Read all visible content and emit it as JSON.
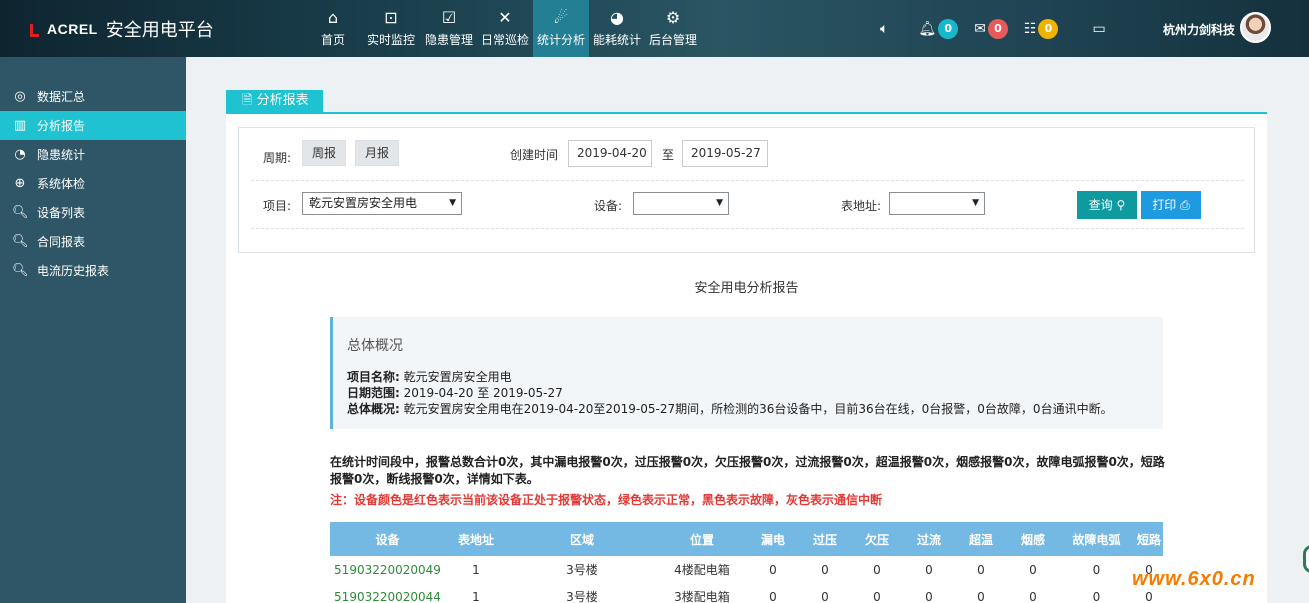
{
  "brand": {
    "logo": "ACREL",
    "title": "安全用电平台"
  },
  "nav": [
    {
      "label": "首页",
      "icon": "home-icon",
      "glyph": "⌂"
    },
    {
      "label": "实时监控",
      "icon": "monitor-search-icon",
      "glyph": "⊡"
    },
    {
      "label": "隐患管理",
      "icon": "clipboard-check-icon",
      "glyph": "☑"
    },
    {
      "label": "日常巡检",
      "icon": "tools-icon",
      "glyph": "✕"
    },
    {
      "label": "统计分析",
      "icon": "analysis-icon",
      "glyph": "☄"
    },
    {
      "label": "能耗统计",
      "icon": "pie-chart-icon",
      "glyph": "◕"
    },
    {
      "label": "后台管理",
      "icon": "gears-icon",
      "glyph": "⚙"
    }
  ],
  "header_tools": {
    "bell_count": "0",
    "mail_count": "0",
    "list_count": "0",
    "company": "杭州力剑科技"
  },
  "sidebar": [
    {
      "label": "数据汇总",
      "icon": "dashboard-icon",
      "glyph": "◎"
    },
    {
      "label": "分析报告",
      "icon": "bar-chart-icon",
      "glyph": "▥"
    },
    {
      "label": "隐患统计",
      "icon": "clock-icon",
      "glyph": "◔"
    },
    {
      "label": "系统体检",
      "icon": "plus-circle-icon",
      "glyph": "⊕"
    },
    {
      "label": "设备列表",
      "icon": "search-icon",
      "glyph": "🔍︎"
    },
    {
      "label": "合同报表",
      "icon": "search-icon",
      "glyph": "🔍︎"
    },
    {
      "label": "电流历史报表",
      "icon": "search-icon",
      "glyph": "🔍︎"
    }
  ],
  "panel": {
    "tab_label": "分析报表"
  },
  "filter": {
    "period_label": "周期:",
    "weekly": "周报",
    "monthly": "月报",
    "created_label": "创建时间",
    "start_date": "2019-04-20",
    "to": "至",
    "end_date": "2019-05-27",
    "project_label": "项目:",
    "project_value": "乾元安置房安全用电",
    "device_label": "设备:",
    "device_value": "",
    "meter_label": "表地址:",
    "meter_value": "",
    "query": "查询",
    "print": "打印"
  },
  "report": {
    "title": "安全用电分析报告",
    "overview_head": "总体概况",
    "project_key": "项目名称:",
    "project_val": "乾元安置房安全用电",
    "range_key": "日期范围:",
    "range_val": "2019-04-20 至 2019-05-27",
    "summary_key": "总体概况:",
    "summary_val": "乾元安置房安全用电在2019-04-20至2019-05-27期间，所检测的36台设备中，目前36台在线，0台报警，0台故障，0台通讯中断。",
    "stats": "在统计时间段中，报警总数合计0次，其中漏电报警0次，过压报警0次，欠压报警0次，过流报警0次，超温报警0次，烟感报警0次，故障电弧报警0次，短路报警0次，断线报警0次，详情如下表。",
    "note": "注：设备颜色是红色表示当前该设备正处于报警状态，绿色表示正常，黑色表示故障，灰色表示通信中断"
  },
  "table": {
    "headers": [
      "设备",
      "表地址",
      "区域",
      "位置",
      "漏电",
      "过压",
      "欠压",
      "过流",
      "超温",
      "烟感",
      "故障电弧",
      "短路"
    ],
    "rows": [
      [
        "51903220020049",
        "1",
        "3号楼",
        "4楼配电箱",
        "0",
        "0",
        "0",
        "0",
        "0",
        "0",
        "0",
        "0"
      ],
      [
        "51903220020044",
        "1",
        "3号楼",
        "3楼配电箱",
        "0",
        "0",
        "0",
        "0",
        "0",
        "0",
        "0",
        "0"
      ]
    ]
  },
  "watermark": "www.6x0.cn"
}
